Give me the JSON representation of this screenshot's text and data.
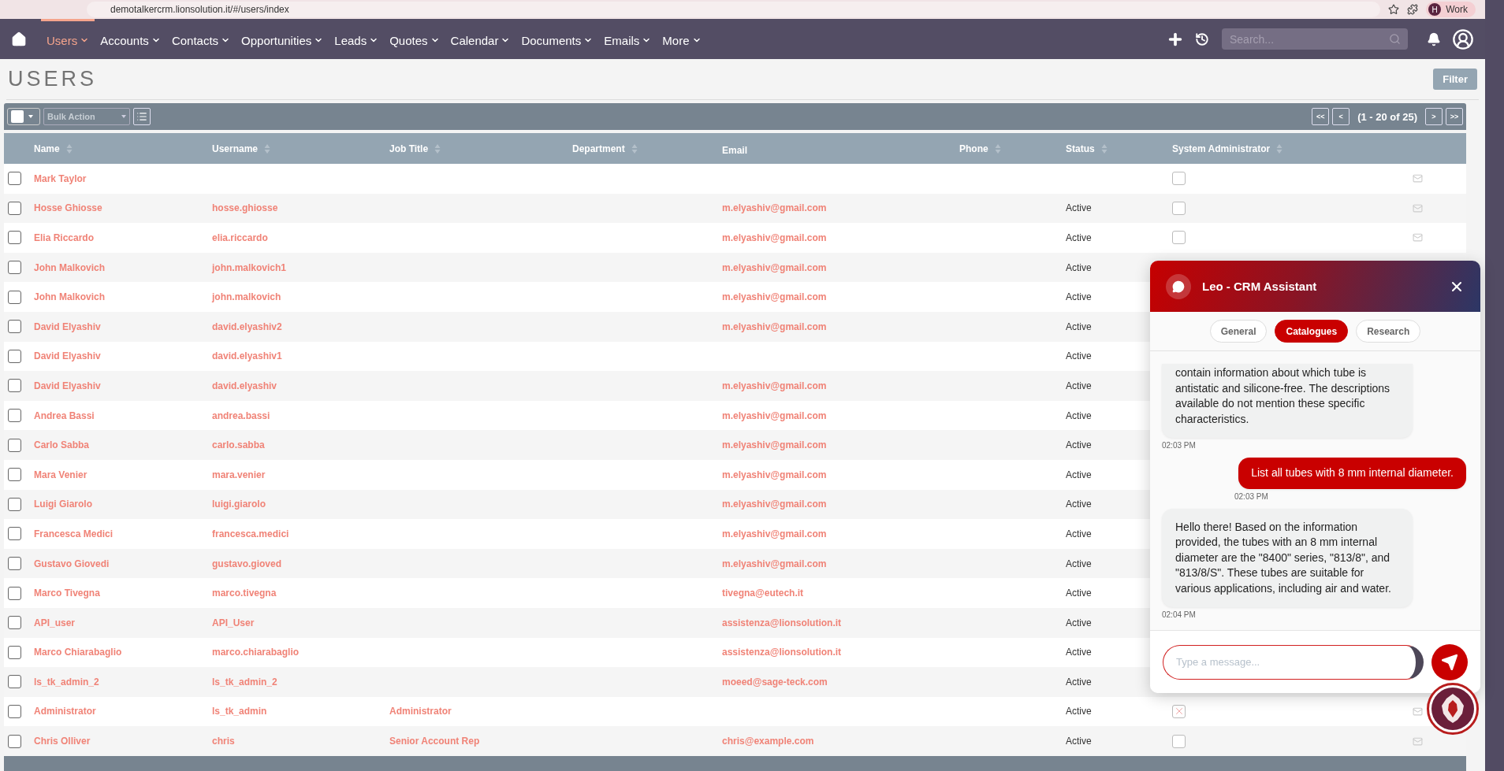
{
  "browser": {
    "url": "demotalkercrm.lionsolution.it/#/users/index",
    "profile_initial": "H",
    "profile": "Work"
  },
  "nav": {
    "items": [
      {
        "label": "Users",
        "selected": true
      },
      {
        "label": "Accounts",
        "selected": false
      },
      {
        "label": "Contacts",
        "selected": false
      },
      {
        "label": "Opportunities",
        "selected": false
      },
      {
        "label": "Leads",
        "selected": false
      },
      {
        "label": "Quotes",
        "selected": false
      },
      {
        "label": "Calendar",
        "selected": false
      },
      {
        "label": "Documents",
        "selected": false
      },
      {
        "label": "Emails",
        "selected": false
      },
      {
        "label": "More",
        "selected": false
      }
    ],
    "search": {
      "placeholder": "Search..."
    }
  },
  "page": {
    "title": "USERS",
    "filter_button": "Filter"
  },
  "toolbar": {
    "bulk_action": "Bulk Action",
    "pagination": {
      "first": "<<",
      "prev": "<",
      "range": "(1 - 20 of 25)",
      "next": ">",
      "last": ">>"
    }
  },
  "table": {
    "columns": [
      {
        "label": "Name",
        "sortable": true
      },
      {
        "label": "Username",
        "sortable": true
      },
      {
        "label": "Job Title",
        "sortable": true
      },
      {
        "label": "Department",
        "sortable": true
      },
      {
        "label": "Email",
        "sortable": false
      },
      {
        "label": "Phone",
        "sortable": true
      },
      {
        "label": "Status",
        "sortable": true
      },
      {
        "label": "System Administrator",
        "sortable": true
      }
    ],
    "rows": [
      {
        "name": "Mark Taylor",
        "checked": false,
        "system_admin": false
      },
      {
        "name": "Hosse Ghiosse",
        "checked": false,
        "username": "hosse.ghiosse",
        "email": "m.elyashiv@gmail.com",
        "status": "Active",
        "system_admin": false
      },
      {
        "name": "Elia Riccardo",
        "checked": false,
        "username": "elia.riccardo",
        "email": "m.elyashiv@gmail.com",
        "status": "Active",
        "system_admin": false
      },
      {
        "name": "John Malkovich",
        "checked": false,
        "username": "john.malkovich1",
        "email": "m.elyashiv@gmail.com",
        "status": "Active"
      },
      {
        "name": "John Malkovich",
        "checked": false,
        "username": "john.malkovich",
        "email": "m.elyashiv@gmail.com",
        "status": "Active"
      },
      {
        "name": "David Elyashiv",
        "checked": false,
        "username": "david.elyashiv2",
        "email": "m.elyashiv@gmail.com",
        "status": "Active"
      },
      {
        "name": "David Elyashiv",
        "checked": false,
        "username": "david.elyashiv1",
        "status": "Active"
      },
      {
        "name": "David Elyashiv",
        "checked": false,
        "username": "david.elyashiv",
        "email": "m.elyashiv@gmail.com",
        "status": "Active"
      },
      {
        "name": "Andrea Bassi",
        "checked": false,
        "username": "andrea.bassi",
        "email": "m.elyashiv@gmail.com",
        "status": "Active"
      },
      {
        "name": "Carlo Sabba",
        "checked": false,
        "username": "carlo.sabba",
        "email": "m.elyashiv@gmail.com",
        "status": "Active"
      },
      {
        "name": "Mara Venier",
        "checked": false,
        "username": "mara.venier",
        "email": "m.elyashiv@gmail.com",
        "status": "Active"
      },
      {
        "name": "Luigi Giarolo",
        "checked": false,
        "username": "luigi.giarolo",
        "email": "m.elyashiv@gmail.com",
        "status": "Active"
      },
      {
        "name": "Francesca Medici",
        "checked": false,
        "username": "francesca.medici",
        "email": "m.elyashiv@gmail.com",
        "status": "Active"
      },
      {
        "name": "Gustavo Giovedi",
        "checked": false,
        "username": "gustavo.gioved",
        "email": "m.elyashiv@gmail.com",
        "status": "Active"
      },
      {
        "name": "Marco Tivegna",
        "checked": false,
        "username": "marco.tivegna",
        "email": "tivegna@eutech.it",
        "status": "Active"
      },
      {
        "name": "API_user",
        "checked": false,
        "username": "API_User",
        "email": "assistenza@lionsolution.it",
        "status": "Active"
      },
      {
        "name": "Marco Chiarabaglio",
        "checked": false,
        "username": "marco.chiarabaglio",
        "email": "assistenza@lionsolution.it",
        "status": "Active"
      },
      {
        "name": "ls_tk_admin_2",
        "checked": false,
        "username": "ls_tk_admin_2",
        "email": "moeed@sage-teck.com",
        "status": "Active"
      },
      {
        "name": "Administrator",
        "checked": false,
        "username": "ls_tk_admin",
        "job_title": "Administrator",
        "status": "Active",
        "system_admin": true
      },
      {
        "name": "Chris Olliver",
        "checked": false,
        "username": "chris",
        "job_title": "Senior Account Rep",
        "email": "chris@example.com",
        "status": "Active",
        "system_admin": false
      }
    ]
  },
  "chat": {
    "title": "Leo - CRM Assistant",
    "tabs": [
      {
        "label": "General",
        "selected": false
      },
      {
        "label": "Catalogues",
        "selected": true
      },
      {
        "label": "Research",
        "selected": false
      }
    ],
    "messages": [
      {
        "kind": "bot",
        "text": "contain information about which tube is antistatic and silicone-free. The descriptions available do not mention these specific characteristics.",
        "time": "02:03 PM"
      },
      {
        "kind": "user",
        "text": "List all tubes with 8 mm internal diameter.",
        "time": "02:03 PM"
      },
      {
        "kind": "bot",
        "text": "Hello there! Based on the information provided, the tubes with an 8 mm internal diameter are the \"8400\" series, \"813/8\", and \"813/8/S\". These tubes are suitable for various applications, including air and water.",
        "time": "02:04 PM"
      }
    ],
    "input": {
      "placeholder": "Type a message..."
    }
  }
}
